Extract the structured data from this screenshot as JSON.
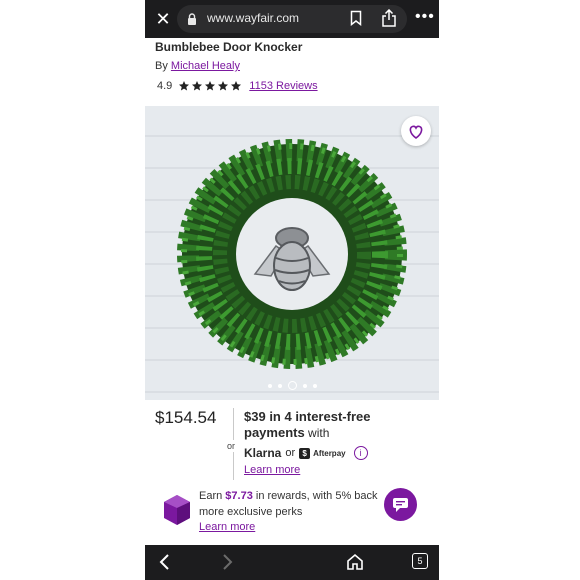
{
  "browser": {
    "url": "www.wayfair.com",
    "tabs_count": "5"
  },
  "product": {
    "title": "Bumblebee Door Knocker",
    "by_label": "By",
    "designer": "Michael Healy",
    "rating": "4.9",
    "stars": 5,
    "reviews_link": "1153 Reviews"
  },
  "gallery": {
    "image_count": 5,
    "active_index": 2
  },
  "pricing": {
    "price": "$154.54",
    "or_label": "or",
    "installment_amount": "$39",
    "installment_text": " in 4 interest-free",
    "installment_text2": "payments",
    "installment_text3": " with",
    "klarna": "Klarna",
    "connector": "or",
    "afterpay": "Afterpay",
    "learn_more": "Learn more"
  },
  "rewards": {
    "earn_prefix": "Earn ",
    "amount": "$7.73",
    "earn_suffix": " in rewards, with 5% back",
    "more_line": "more exclusive perks",
    "learn_more": "Learn more"
  },
  "colors": {
    "accent": "#7b189f",
    "bar_bg": "#1c1c1e"
  },
  "icons": [
    "close-icon",
    "lock-icon",
    "bookmark-icon",
    "share-icon",
    "more-icon",
    "star-icon",
    "heart-icon",
    "info-icon",
    "gem-icon",
    "chat-icon",
    "back-icon",
    "forward-icon",
    "home-icon",
    "tabs-icon"
  ]
}
